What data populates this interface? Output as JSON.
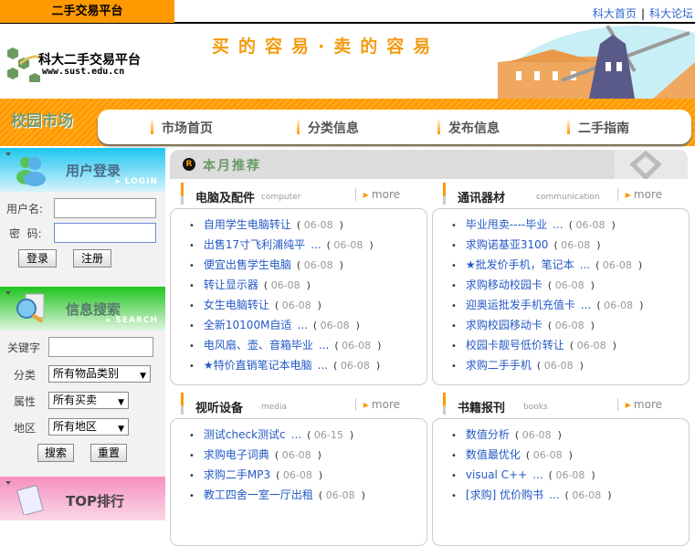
{
  "topbar": {
    "site_tab": "二手交易平台",
    "links": [
      "科大首页",
      "科大论坛"
    ],
    "separator": "|"
  },
  "banner": {
    "logo_title": "科大二手交易平台",
    "logo_url": "www.sust.edu.cn",
    "slogan": "买的容易·卖的容易"
  },
  "navbar": {
    "brand": "校园市场",
    "items": [
      "市场首页",
      "分类信息",
      "发布信息",
      "二手指南"
    ]
  },
  "login": {
    "title": "用户登录",
    "subtitle": "LOGIN",
    "username_label": "用户名:",
    "password_label": "密  码:",
    "username_value": "",
    "password_value": "",
    "login_button": "登录",
    "register_button": "注册"
  },
  "search": {
    "title": "信息搜索",
    "subtitle": "SEARCH",
    "keyword_label": "关键字",
    "keyword_value": "",
    "category_label": "分类",
    "category_value": "所有物品类别",
    "attribute_label": "属性",
    "attribute_value": "所有买卖",
    "region_label": "地区",
    "region_value": "所有地区",
    "search_button": "搜索",
    "reset_button": "重置"
  },
  "top_rank": {
    "title": "TOP排行"
  },
  "main": {
    "badge": "R",
    "title": "本月推荐",
    "more_label": "more",
    "sections": [
      {
        "title": "电脑及配件",
        "en": "computer",
        "items": [
          {
            "title": "自用学生电脑转让",
            "ellipsis": false,
            "date": "06-08"
          },
          {
            "title": "出售17寸飞利浦纯平",
            "ellipsis": true,
            "date": "06-08"
          },
          {
            "title": "便宜出售学生电脑",
            "ellipsis": false,
            "date": "06-08"
          },
          {
            "title": "转让显示器",
            "ellipsis": false,
            "date": "06-08"
          },
          {
            "title": "女生电脑转让",
            "ellipsis": false,
            "date": "06-08"
          },
          {
            "title": "全新10100M自适",
            "ellipsis": true,
            "date": "06-08"
          },
          {
            "title": "电风扇、壶、音箱毕业",
            "ellipsis": true,
            "date": "06-08"
          },
          {
            "title": "★特价直销笔记本电脑",
            "ellipsis": true,
            "date": "06-08"
          }
        ]
      },
      {
        "title": "通讯器材",
        "en": "communication",
        "items": [
          {
            "title": "毕业甩卖----毕业",
            "ellipsis": true,
            "date": "06-08"
          },
          {
            "title": "求购诺基亚3100",
            "ellipsis": false,
            "date": "06-08"
          },
          {
            "title": "★批发价手机，笔记本",
            "ellipsis": true,
            "date": "06-08"
          },
          {
            "title": "求购移动校园卡",
            "ellipsis": false,
            "date": "06-08"
          },
          {
            "title": "迎奥运批发手机充值卡",
            "ellipsis": true,
            "date": "06-08"
          },
          {
            "title": "求购校园移动卡",
            "ellipsis": false,
            "date": "06-08"
          },
          {
            "title": "校园卡靓号低价转让",
            "ellipsis": false,
            "date": "06-08"
          },
          {
            "title": "求购二手手机",
            "ellipsis": false,
            "date": "06-08"
          }
        ]
      },
      {
        "title": "视听设备",
        "en": "media",
        "items": [
          {
            "title": "测试check测试c",
            "ellipsis": true,
            "date": "06-15"
          },
          {
            "title": "求购电子词典",
            "ellipsis": false,
            "date": "06-08"
          },
          {
            "title": "求购二手MP3",
            "ellipsis": false,
            "date": "06-08"
          },
          {
            "title": "教工四舍一室一厅出租",
            "ellipsis": false,
            "date": "06-08"
          }
        ]
      },
      {
        "title": "书籍报刊",
        "en": "books",
        "items": [
          {
            "title": "数值分析",
            "ellipsis": false,
            "date": "06-08"
          },
          {
            "title": "数值最优化",
            "ellipsis": false,
            "date": "06-08"
          },
          {
            "title": "visual C++",
            "ellipsis": true,
            "date": "06-08"
          },
          {
            "title": "[求购] 优价购书",
            "ellipsis": true,
            "date": "06-08"
          }
        ]
      }
    ]
  }
}
